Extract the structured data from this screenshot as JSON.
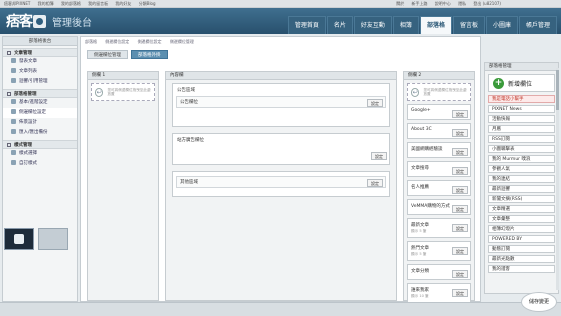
{
  "topbar": {
    "links": [
      "痞客邦PIXNET",
      "我的相簿",
      "我的部落格",
      "我的留言板",
      "我的好友",
      "分類Blog"
    ],
    "right_links": [
      "關於",
      "新手上路",
      "說明中心",
      "隱私",
      "登出 (u82107)"
    ]
  },
  "header": {
    "logo_text": "痞客",
    "subtitle": "管理後台"
  },
  "nav": {
    "tabs": [
      "管理首頁",
      "名片",
      "好友互動",
      "相簿",
      "部落格",
      "留言板",
      "小圖庫",
      "帳戶管理"
    ],
    "active_index": 4
  },
  "sidebar": {
    "title": "部落格後台",
    "sections": [
      {
        "label": "文章管理",
        "items": [
          "發表文章",
          "文章列表",
          "迴響/引用管理"
        ]
      },
      {
        "label": "部落格管理",
        "items": [
          "基本/進階設定",
          "側邊欄位設定",
          "佈景設計",
          "匯入/匯出備份"
        ]
      },
      {
        "label": "樣式管理",
        "items": [
          "樣式選擇",
          "自訂樣式"
        ]
      }
    ],
    "selected_item": "側邊欄位設定"
  },
  "breadcrumb": [
    "部落格",
    "側邊欄位設定",
    "側邊欄位設定",
    "側邊欄位管理"
  ],
  "subtabs": [
    "側邊欄位管理",
    "部落格外掛"
  ],
  "active_subtab": 1,
  "columns": {
    "left": {
      "title": "側欄 1",
      "drop_text": "您可將側邊欄位拖曳至此處放置"
    },
    "middle": {
      "title": "內容欄",
      "blocks": [
        {
          "title": "公告區域",
          "inner": "公告欄位"
        },
        {
          "title": "站方廣告欄位",
          "inner": ""
        },
        {
          "title": "",
          "inner": "其他區域"
        }
      ]
    },
    "right": {
      "title": "側欄 2",
      "drop_text": "您可將側邊欄位拖曳至此處放置",
      "items": [
        {
          "label": "Google+",
          "sub": ""
        },
        {
          "label": "About 3C",
          "sub": ""
        },
        {
          "label": "美國網購經驗談",
          "sub": ""
        },
        {
          "label": "文章搜尋",
          "sub": ""
        },
        {
          "label": "名人推薦",
          "sub": ""
        },
        {
          "label": "VeMMA購物的方式",
          "sub": ""
        },
        {
          "label": "最新文章",
          "sub": "顯示 5 筆"
        },
        {
          "label": "熱門文章",
          "sub": "顯示 5 筆"
        },
        {
          "label": "文章分類",
          "sub": ""
        },
        {
          "label": "誰來我家",
          "sub": "顯示 10 筆"
        }
      ]
    }
  },
  "set_label": "設定",
  "widget_panel": {
    "title": "部落格管理",
    "new_button": "新增欄位",
    "items": [
      "我是電話小幫手",
      "PIXNET News",
      "活動快報",
      "月曆",
      "RSS訂閱",
      "小圖職擊表",
      "我的 Murmur 噗浪",
      "參觀人氣",
      "我的連結",
      "最新迴響",
      "新聞文摘(RSS)",
      "文章精選",
      "文章彙整",
      "相簿幻燈片",
      "POWERED BY",
      "動態訂閱",
      "最新光點數",
      "我的證客"
    ]
  },
  "save_button": "儲存變更"
}
